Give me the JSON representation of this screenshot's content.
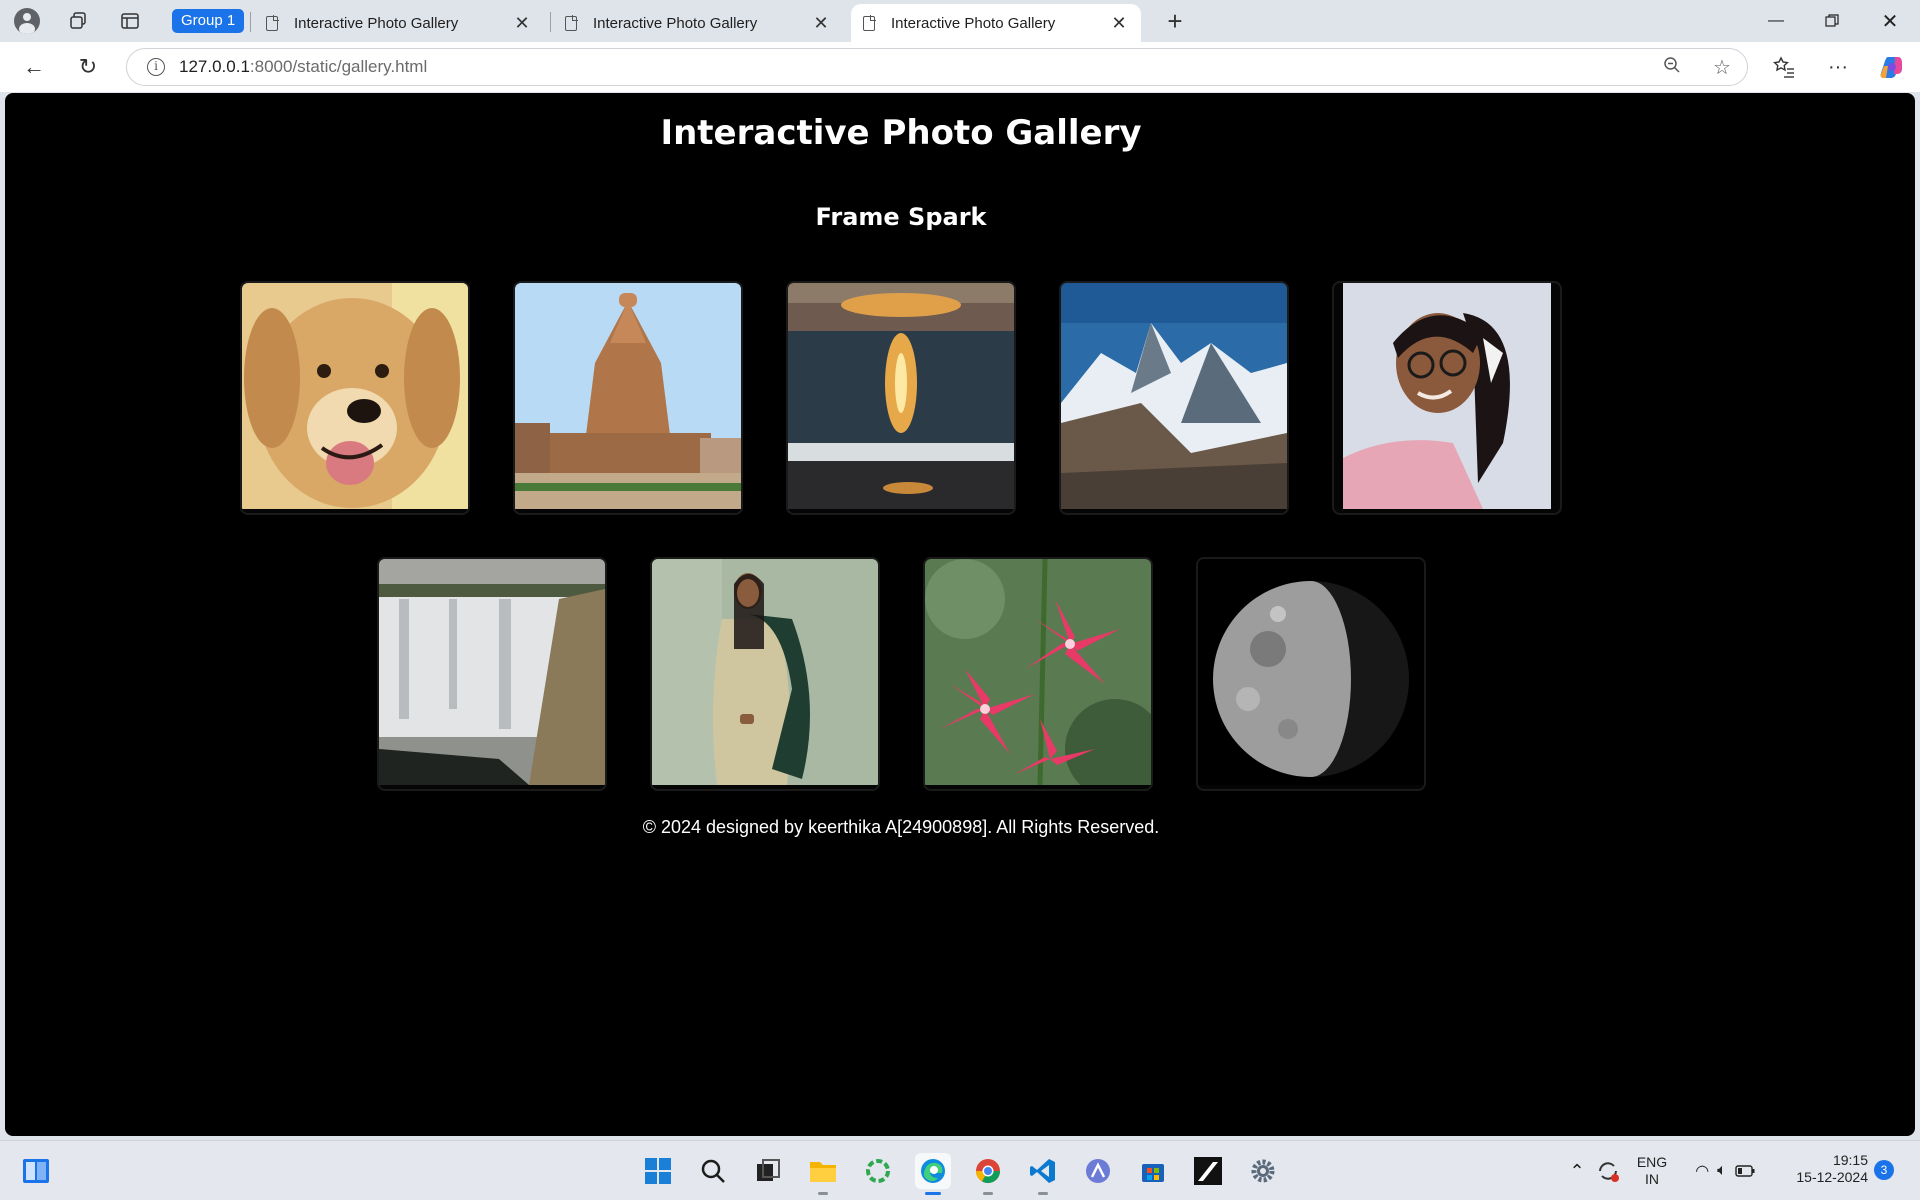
{
  "browser": {
    "group_label": "Group 1",
    "tabs": [
      {
        "title": "Interactive Photo Gallery"
      },
      {
        "title": "Interactive Photo Gallery"
      },
      {
        "title": "Interactive Photo Gallery"
      }
    ],
    "url_host": "127.0.0.1",
    "url_rest": ":8000/static/gallery.html"
  },
  "page": {
    "title": "Interactive Photo Gallery",
    "subtitle": "Frame Spark",
    "photos_row1": [
      "golden-retriever-photo",
      "brihadeeswarar-temple-photo",
      "ocean-sunset-photo",
      "mountain-range-photo",
      "woman-portrait-photo"
    ],
    "photos_row2": [
      "waterfall-photo",
      "woman-standing-photo",
      "pink-flowers-photo",
      "half-moon-photo"
    ],
    "footer": "© 2024 designed by keerthika A[24900898]. All Rights Reserved."
  },
  "taskbar": {
    "language": "ENG",
    "region": "IN",
    "time": "19:15",
    "date": "15-12-2024",
    "notification_count": "3"
  }
}
